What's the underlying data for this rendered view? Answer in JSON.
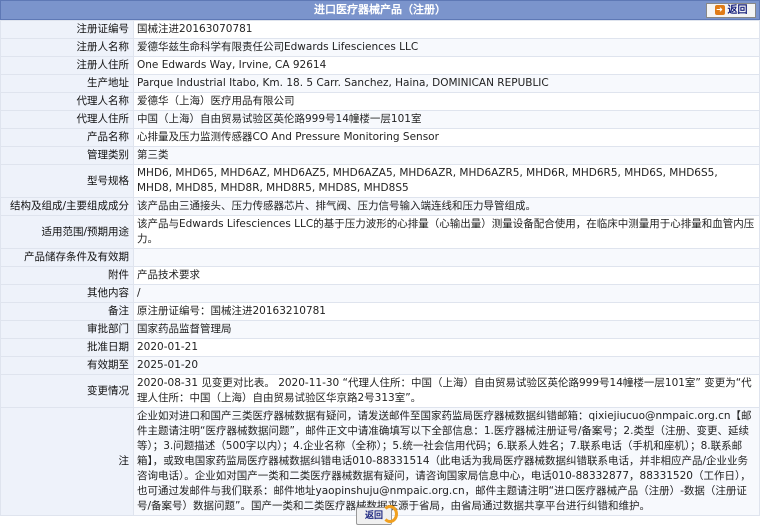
{
  "header": {
    "title": "进口医疗器械产品（注册）",
    "back_label": "返回"
  },
  "fields": [
    {
      "label": "注册证编号",
      "value": "国械注进20163070781"
    },
    {
      "label": "注册人名称",
      "value": "爱德华兹生命科学有限责任公司Edwards Lifesciences LLC"
    },
    {
      "label": "注册人住所",
      "value": "One Edwards Way, Irvine, CA 92614"
    },
    {
      "label": "生产地址",
      "value": "Parque Industrial Itabo, Km. 18. 5 Carr. Sanchez, Haina, DOMINICAN REPUBLIC"
    },
    {
      "label": "代理人名称",
      "value": "爱德华（上海）医疗用品有限公司"
    },
    {
      "label": "代理人住所",
      "value": "中国（上海）自由贸易试验区英伦路999号14幢楼一层101室"
    },
    {
      "label": "产品名称",
      "value": "心排量及压力监测传感器CO And Pressure Monitoring Sensor"
    },
    {
      "label": "管理类别",
      "value": "第三类"
    },
    {
      "label": "型号规格",
      "value": "MHD6, MHD65, MHD6AZ, MHD6AZ5, MHD6AZA5, MHD6AZR, MHD6AZR5, MHD6R, MHD6R5, MHD6S, MHD6S5, MHD8, MHD85, MHD8R, MHD8R5, MHD8S, MHD8S5"
    },
    {
      "label": "结构及组成/主要组成成分",
      "value": "该产品由三通接头、压力传感器芯片、排气阀、压力信号输入端连线和压力导管组成。"
    },
    {
      "label": "适用范围/预期用途",
      "value": "该产品与Edwards Lifesciences LLC的基于压力波形的心排量（心输出量）测量设备配合使用，在临床中测量用于心排量和血管内压力。"
    },
    {
      "label": "产品储存条件及有效期",
      "value": ""
    },
    {
      "label": "附件",
      "value": "产品技术要求"
    },
    {
      "label": "其他内容",
      "value": "/"
    },
    {
      "label": "备注",
      "value": "原注册证编号：国械注进20163210781"
    },
    {
      "label": "审批部门",
      "value": "国家药品监督管理局"
    },
    {
      "label": "批准日期",
      "value": "2020-01-21"
    },
    {
      "label": "有效期至",
      "value": "2025-01-20"
    },
    {
      "label": "变更情况",
      "value": "2020-08-31 见变更对比表。 2020-11-30 “代理人住所：中国（上海）自由贸易试验区英伦路999号14幢楼一层101室” 变更为“代理人住所：中国（上海）自由贸易试验区华京路2号313室”。"
    },
    {
      "label": "注",
      "value": "企业如对进口和国产三类医疗器械数据有疑问，请发送邮件至国家药监局医疗器械数据纠错邮箱：qixiejiucuo@nmpaic.org.cn【邮件主题请注明“医疗器械数据问题”，邮件正文中请准确填写以下全部信息：1.医疗器械注册证号/备案号；2.类型（注册、变更、延续等）；3.问题描述（500字以内）；4.企业名称（全称）；5.统一社会信用代码；6.联系人姓名；7.联系电话（手机和座机）；8.联系邮箱】，或致电国家药监局医疗器械数据纠错电话010-88331514（此电话为我局医疗器械数据纠错联系电话，并非相应产品/企业业务咨询电话）。企业如对国产一类和二类医疗器械数据有疑问，请咨询国家局信息中心，电话010-88332877，88331520（工作日），也可通过发邮件与我们联系：邮件地址yaopinshuju@nmpaic.org.cn，邮件主题请注明“进口医疗器械产品（注册）-数据（注册证号/备案号）数据问题”。国产一类和二类医疗器械数据来源于省局，由省局通过数据共享平台进行纠错和维护。"
    }
  ],
  "footer": {
    "back_label": "返回"
  },
  "colors": {
    "header_bg": "#7b94cc",
    "label_bg": "#eef2fa",
    "border": "#dfe4ee",
    "back_accent": "#e07b16"
  }
}
